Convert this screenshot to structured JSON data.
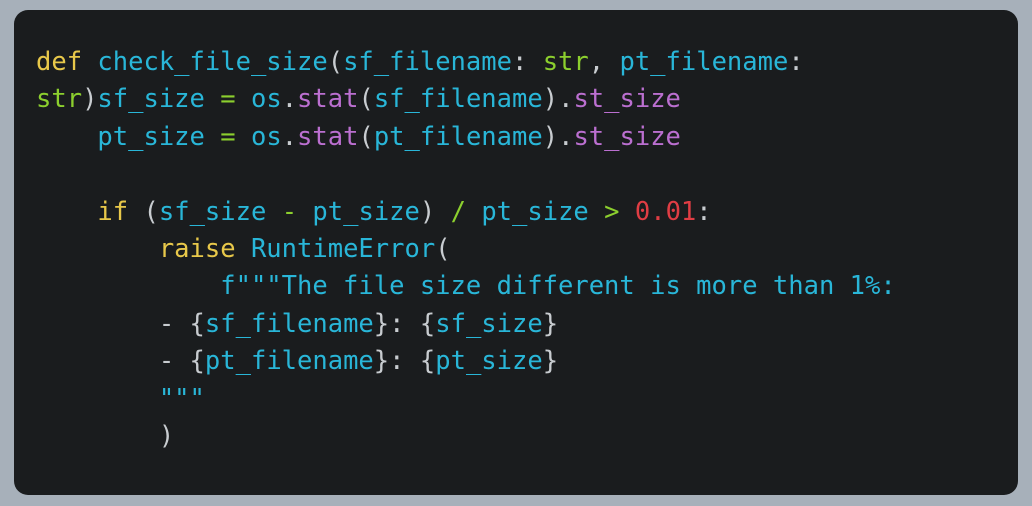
{
  "window": {
    "kind": "code-snippet-screenshot",
    "background_color": "#a7b0ba",
    "card_background_color": "#1a1c1e",
    "language": "python"
  },
  "theme": {
    "keyword_color": "#e8c84a",
    "identifier_color": "#29b6d8",
    "type_operator_color": "#8ccf2e",
    "punctuation_color": "#c8ccd0",
    "attribute_color": "#bb6fd0",
    "number_color": "#e03d44",
    "string_color": "#29b6d8"
  },
  "code": {
    "lines": [
      {
        "index": 0,
        "text": "def check_file_size(sf_filename: str, pt_filename:",
        "tokens": [
          {
            "t": "def",
            "c": "kw"
          },
          {
            "t": " ",
            "c": "punc"
          },
          {
            "t": "check_file_size",
            "c": "name"
          },
          {
            "t": "(",
            "c": "punc"
          },
          {
            "t": "sf_filename",
            "c": "name"
          },
          {
            "t": ":",
            "c": "punc"
          },
          {
            "t": " ",
            "c": "punc"
          },
          {
            "t": "str",
            "c": "type"
          },
          {
            "t": ",",
            "c": "punc"
          },
          {
            "t": " ",
            "c": "punc"
          },
          {
            "t": "pt_filename",
            "c": "name"
          },
          {
            "t": ":",
            "c": "punc"
          }
        ]
      },
      {
        "index": 1,
        "text": "str)sf_size = os.stat(sf_filename).st_size",
        "tokens": [
          {
            "t": "str",
            "c": "type"
          },
          {
            "t": ")",
            "c": "punc"
          },
          {
            "t": "sf_size",
            "c": "name"
          },
          {
            "t": " ",
            "c": "punc"
          },
          {
            "t": "=",
            "c": "op"
          },
          {
            "t": " ",
            "c": "punc"
          },
          {
            "t": "os",
            "c": "name"
          },
          {
            "t": ".",
            "c": "punc"
          },
          {
            "t": "stat",
            "c": "attr"
          },
          {
            "t": "(",
            "c": "punc"
          },
          {
            "t": "sf_filename",
            "c": "name"
          },
          {
            "t": ")",
            "c": "punc"
          },
          {
            "t": ".",
            "c": "punc"
          },
          {
            "t": "st_size",
            "c": "attr"
          }
        ]
      },
      {
        "index": 2,
        "text": "    pt_size = os.stat(pt_filename).st_size",
        "tokens": [
          {
            "t": "    ",
            "c": "punc"
          },
          {
            "t": "pt_size",
            "c": "name"
          },
          {
            "t": " ",
            "c": "punc"
          },
          {
            "t": "=",
            "c": "op"
          },
          {
            "t": " ",
            "c": "punc"
          },
          {
            "t": "os",
            "c": "name"
          },
          {
            "t": ".",
            "c": "punc"
          },
          {
            "t": "stat",
            "c": "attr"
          },
          {
            "t": "(",
            "c": "punc"
          },
          {
            "t": "pt_filename",
            "c": "name"
          },
          {
            "t": ")",
            "c": "punc"
          },
          {
            "t": ".",
            "c": "punc"
          },
          {
            "t": "st_size",
            "c": "attr"
          }
        ]
      },
      {
        "index": 3,
        "text": "",
        "tokens": []
      },
      {
        "index": 4,
        "text": "    if (sf_size - pt_size) / pt_size > 0.01:",
        "tokens": [
          {
            "t": "    ",
            "c": "punc"
          },
          {
            "t": "if",
            "c": "kw"
          },
          {
            "t": " ",
            "c": "punc"
          },
          {
            "t": "(",
            "c": "punc"
          },
          {
            "t": "sf_size",
            "c": "name"
          },
          {
            "t": " ",
            "c": "punc"
          },
          {
            "t": "-",
            "c": "op"
          },
          {
            "t": " ",
            "c": "punc"
          },
          {
            "t": "pt_size",
            "c": "name"
          },
          {
            "t": ")",
            "c": "punc"
          },
          {
            "t": " ",
            "c": "punc"
          },
          {
            "t": "/",
            "c": "op"
          },
          {
            "t": " ",
            "c": "punc"
          },
          {
            "t": "pt_size",
            "c": "name"
          },
          {
            "t": " ",
            "c": "punc"
          },
          {
            "t": ">",
            "c": "op"
          },
          {
            "t": " ",
            "c": "punc"
          },
          {
            "t": "0.01",
            "c": "num"
          },
          {
            "t": ":",
            "c": "punc"
          }
        ]
      },
      {
        "index": 5,
        "text": "        raise RuntimeError(",
        "tokens": [
          {
            "t": "        ",
            "c": "punc"
          },
          {
            "t": "raise",
            "c": "kw"
          },
          {
            "t": " ",
            "c": "punc"
          },
          {
            "t": "RuntimeError",
            "c": "name"
          },
          {
            "t": "(",
            "c": "punc"
          }
        ]
      },
      {
        "index": 6,
        "text": "            f\"\"\"The file size different is more than 1%:",
        "tokens": [
          {
            "t": "            ",
            "c": "punc"
          },
          {
            "t": "f\"\"\"The file size different is more than 1%:",
            "c": "str"
          }
        ]
      },
      {
        "index": 7,
        "text": "        - {sf_filename}: {sf_size}",
        "tokens": [
          {
            "t": "        ",
            "c": "punc"
          },
          {
            "t": "- ",
            "c": "punc"
          },
          {
            "t": "{",
            "c": "punc"
          },
          {
            "t": "sf_filename",
            "c": "name"
          },
          {
            "t": "}",
            "c": "punc"
          },
          {
            "t": ": ",
            "c": "punc"
          },
          {
            "t": "{",
            "c": "punc"
          },
          {
            "t": "sf_size",
            "c": "name"
          },
          {
            "t": "}",
            "c": "punc"
          }
        ]
      },
      {
        "index": 8,
        "text": "        - {pt_filename}: {pt_size}",
        "tokens": [
          {
            "t": "        ",
            "c": "punc"
          },
          {
            "t": "- ",
            "c": "punc"
          },
          {
            "t": "{",
            "c": "punc"
          },
          {
            "t": "pt_filename",
            "c": "name"
          },
          {
            "t": "}",
            "c": "punc"
          },
          {
            "t": ": ",
            "c": "punc"
          },
          {
            "t": "{",
            "c": "punc"
          },
          {
            "t": "pt_size",
            "c": "name"
          },
          {
            "t": "}",
            "c": "punc"
          }
        ]
      },
      {
        "index": 9,
        "text": "        \"\"\"",
        "tokens": [
          {
            "t": "        ",
            "c": "punc"
          },
          {
            "t": "\"\"\"",
            "c": "str"
          }
        ]
      },
      {
        "index": 10,
        "text": "        )",
        "tokens": [
          {
            "t": "        ",
            "c": "punc"
          },
          {
            "t": ")",
            "c": "punc"
          }
        ]
      }
    ]
  }
}
